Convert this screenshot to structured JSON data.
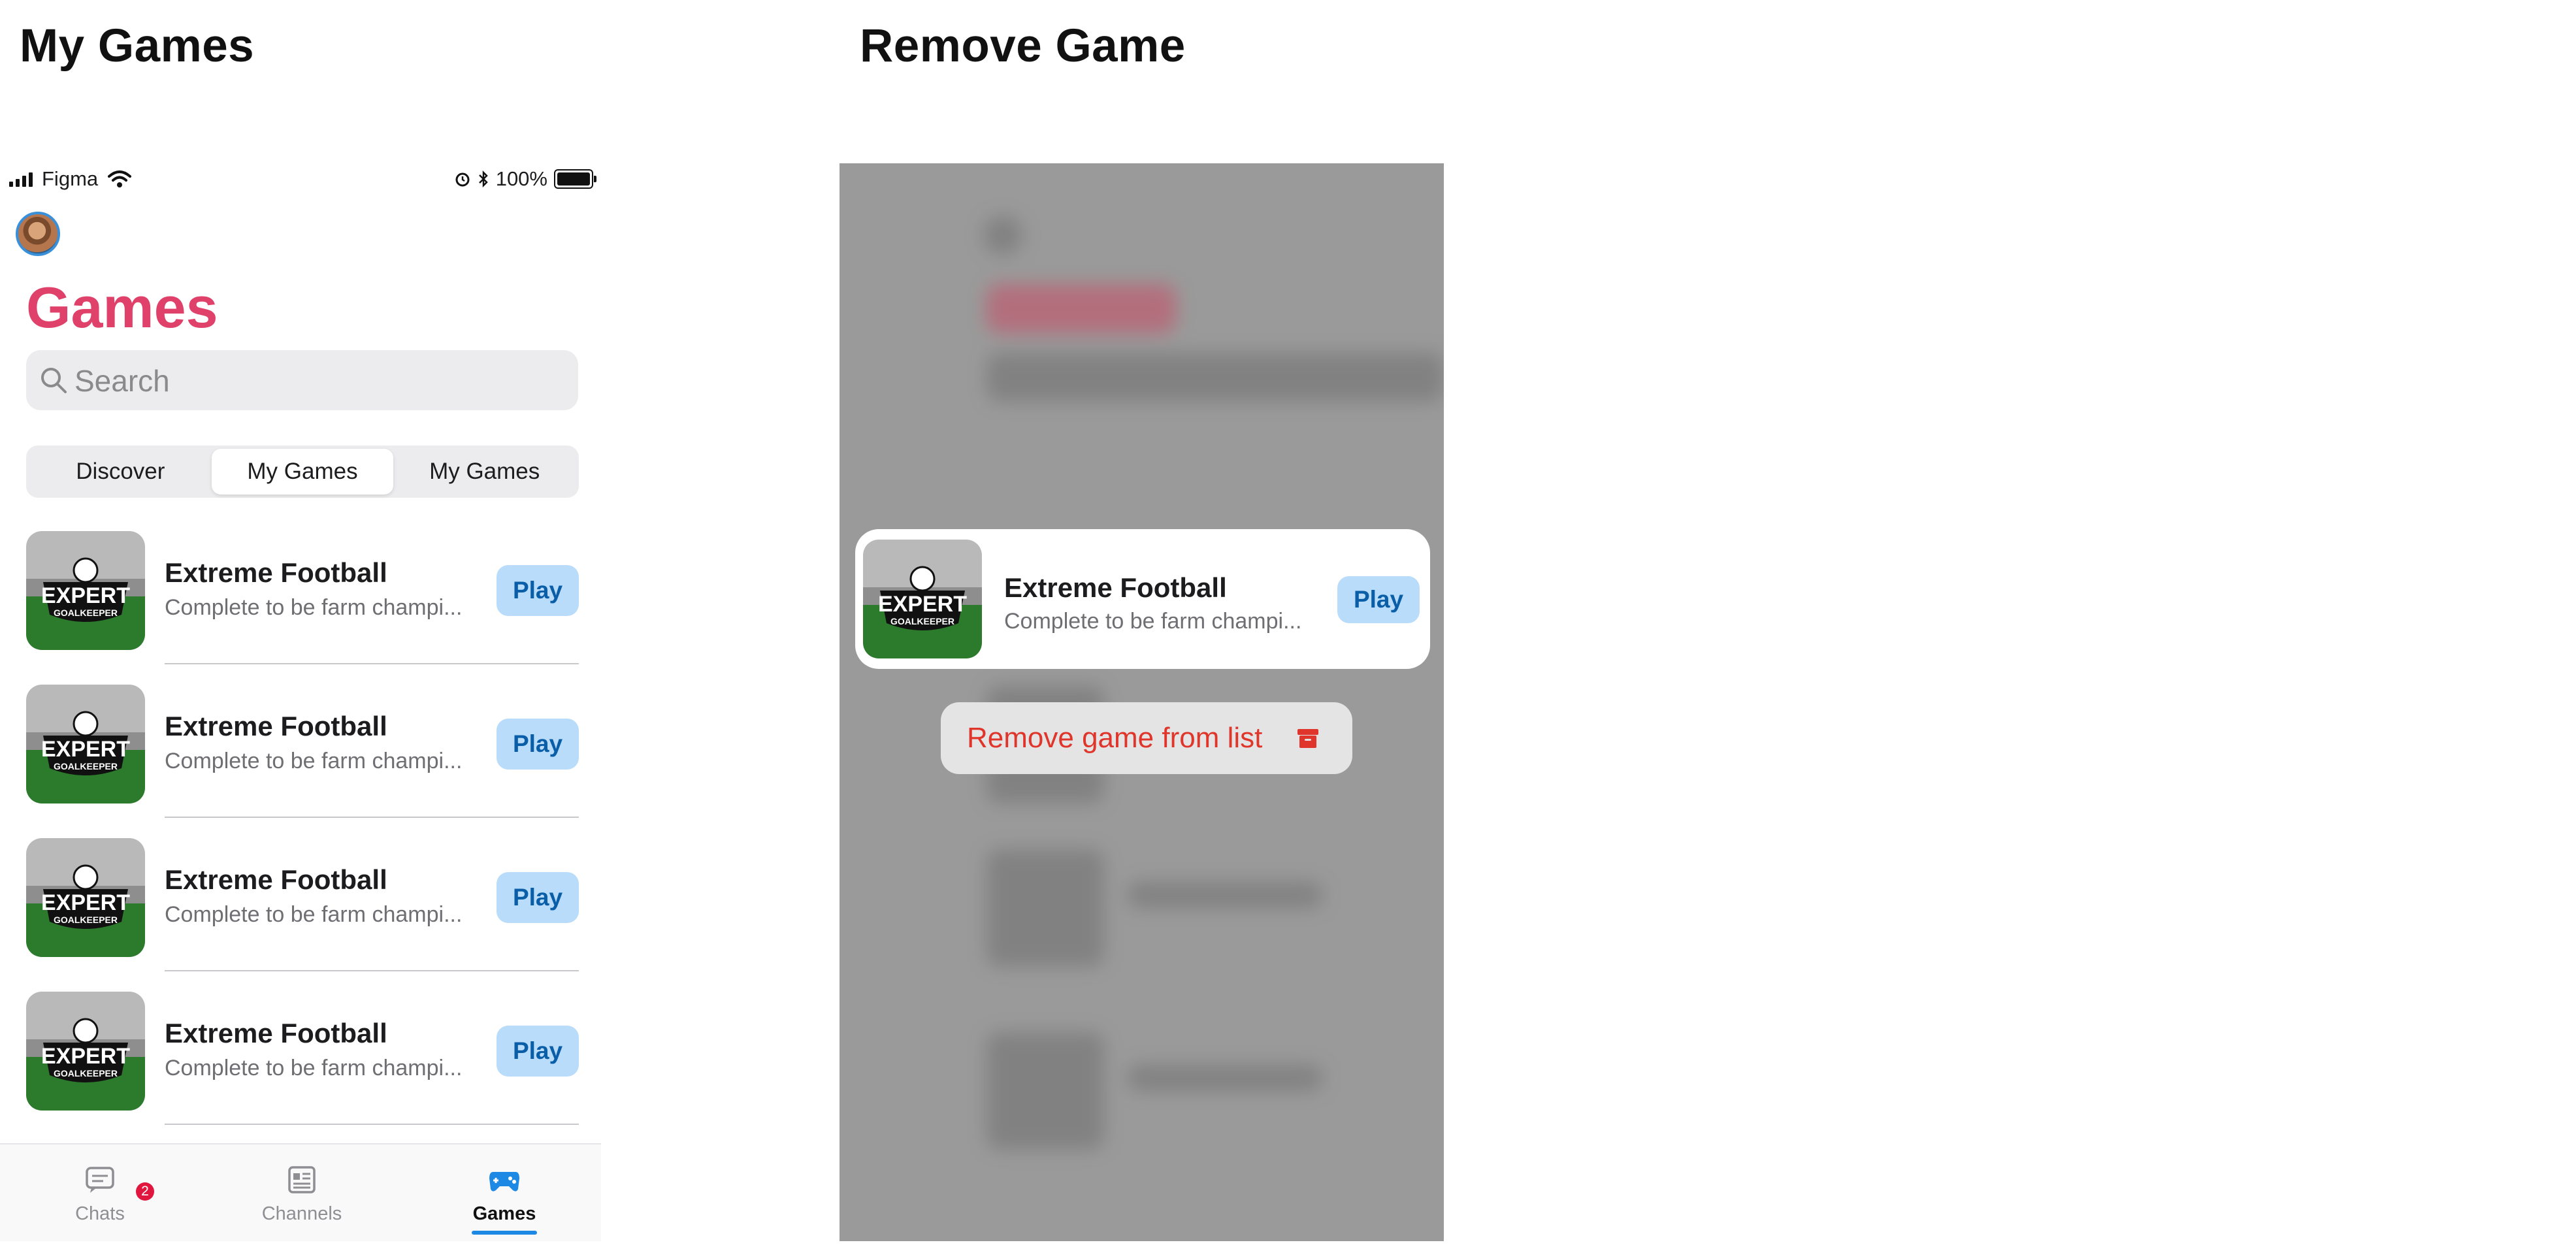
{
  "artboards": {
    "left_title": "My Games",
    "right_title": "Remove Game"
  },
  "status_bar": {
    "carrier": "Figma",
    "battery": "100%",
    "icons": [
      "signal-icon",
      "wifi-icon",
      "alarm-icon",
      "bluetooth-icon",
      "battery-icon"
    ]
  },
  "header": {
    "title": "Games",
    "title_color": "#e0416a"
  },
  "search": {
    "placeholder": "Search"
  },
  "segments": [
    {
      "label": "Discover",
      "active": false
    },
    {
      "label": "My Games",
      "active": true
    },
    {
      "label": "My Games",
      "active": false
    }
  ],
  "games": [
    {
      "name": "Extreme Football",
      "description": "Complete to be farm champi...",
      "action": "Play",
      "thumb_text": [
        "EXPERT",
        "GOALKEEPER"
      ]
    },
    {
      "name": "Extreme Football",
      "description": "Complete to be farm champi...",
      "action": "Play",
      "thumb_text": [
        "EXPERT",
        "GOALKEEPER"
      ]
    },
    {
      "name": "Extreme Football",
      "description": "Complete to be farm champi...",
      "action": "Play",
      "thumb_text": [
        "EXPERT",
        "GOALKEEPER"
      ]
    },
    {
      "name": "Extreme Football",
      "description": "Complete to be farm champi...",
      "action": "Play",
      "thumb_text": [
        "EXPERT",
        "GOALKEEPER"
      ]
    }
  ],
  "tab_bar": {
    "tabs": [
      {
        "label": "Chats",
        "icon": "chat-icon",
        "badge": "2",
        "active": false
      },
      {
        "label": "Channels",
        "icon": "channels-icon",
        "active": false
      },
      {
        "label": "Games",
        "icon": "gamepad-icon",
        "active": true
      }
    ],
    "accent": "#1e88e5"
  },
  "overlay": {
    "card": {
      "name": "Extreme Football",
      "description": "Complete to be farm champi...",
      "action": "Play"
    },
    "menu": {
      "label": "Remove game from list",
      "icon": "archive-trash-icon",
      "color": "#e0352b"
    }
  }
}
